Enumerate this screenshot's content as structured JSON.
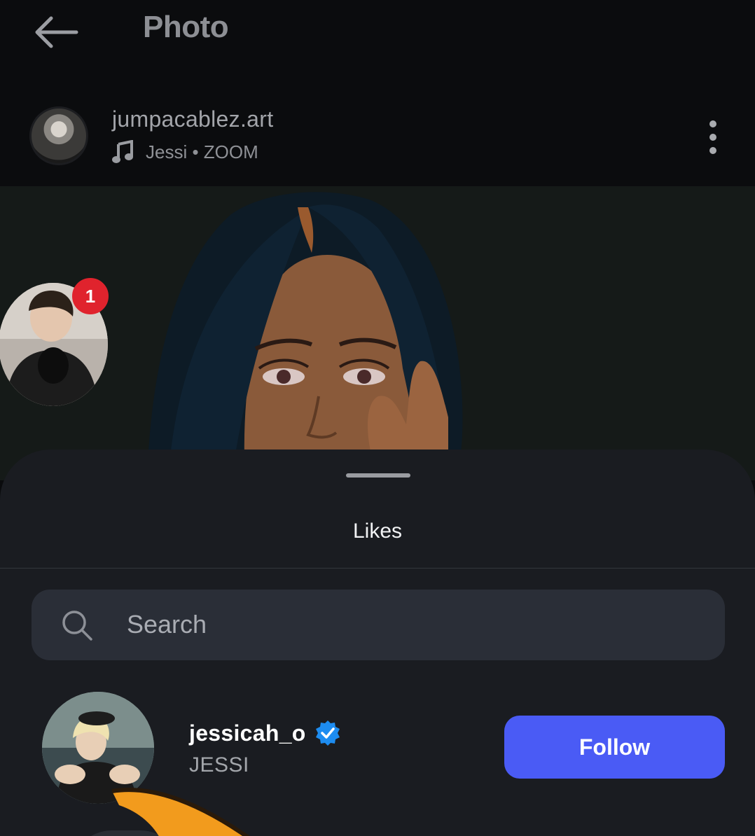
{
  "header": {
    "title": "Photo",
    "back_icon": "arrow-left-icon"
  },
  "post": {
    "author": "jumpacablez.art",
    "music": "Jessi • ZOOM",
    "music_icon": "music-note-icon",
    "more_icon": "more-vertical-icon"
  },
  "bubble": {
    "badge_count": "1"
  },
  "likes_sheet": {
    "title": "Likes",
    "search_placeholder": "Search",
    "users": [
      {
        "username": "jessicah_o",
        "full_name": "JESSI",
        "verified": true,
        "action_label": "Follow"
      }
    ]
  },
  "colors": {
    "background": "#0a0b0d",
    "sheet": "#1a1c21",
    "search_field": "#2a2e37",
    "accent_button": "#4a5bf5",
    "badge": "#e0232d",
    "verified_badge": "#1d8cf0"
  }
}
